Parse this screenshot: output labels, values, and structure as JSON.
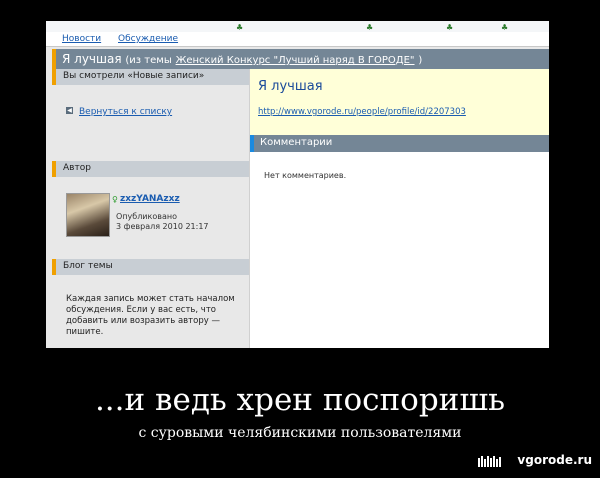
{
  "nav": {
    "news": "Новости",
    "discussion": "Обсуждение"
  },
  "header": {
    "title": "Я лучшая",
    "topic_prefix": "(из темы",
    "topic_link": "Женский Конкурс \"Лучший наряд В ГОРОДЕ\"",
    "topic_suffix": ")"
  },
  "sidebar": {
    "viewed_label": "Вы смотрели «Новые записи»",
    "back_link": "Вернуться к списку",
    "author_label": "Автор",
    "author_name": "zxzYANAzxz",
    "published_label": "Опубликовано",
    "published_date": "3 февраля 2010 21:17",
    "blog_label": "Блог темы",
    "blog_text": "Каждая запись может стать началом обсуждения. Если у вас есть, что добавить или возразить автору — пишите."
  },
  "post": {
    "title": "Я лучшая",
    "url": "http://www.vgorode.ru/people/profile/id/2207303"
  },
  "comments": {
    "header": "Комментарии",
    "empty_text": "Нет комментариев."
  },
  "poster": {
    "caption": "...и ведь хрен поспоришь",
    "subcaption": "с суровыми челябинскими пользователями",
    "brand": "vgorode.ru"
  },
  "colors": {
    "accent_orange": "#f0a000",
    "header_slate": "#748696",
    "link_blue": "#1a5cb0",
    "post_bg": "#ffffd8"
  }
}
